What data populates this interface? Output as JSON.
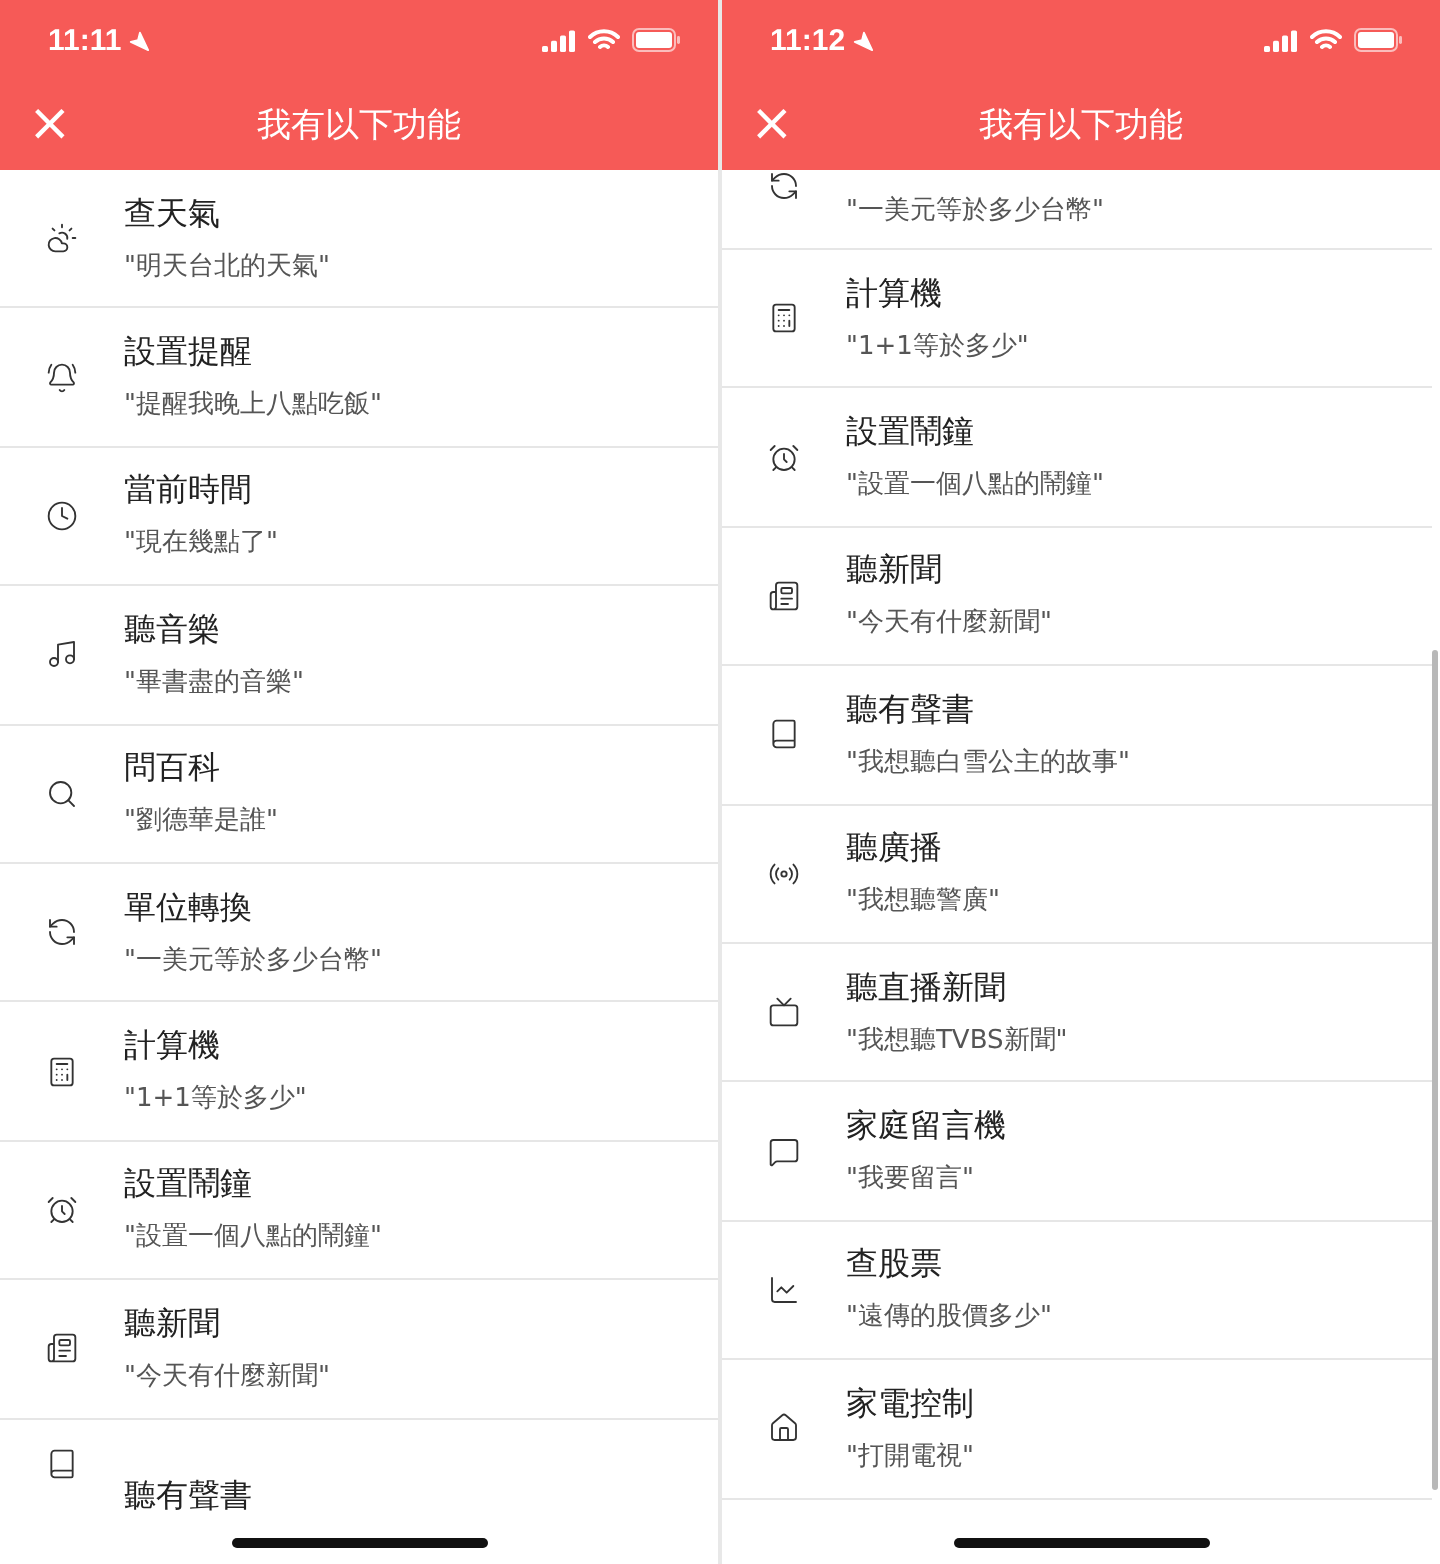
{
  "screens": [
    {
      "status_bar": {
        "time": "11:11"
      },
      "header": {
        "close": "×",
        "title": "我有以下功能"
      },
      "rows": [
        {
          "kind": "full",
          "title": "查天氣",
          "example": "\"明天台北的天氣\""
        },
        {
          "kind": "full",
          "title": "設置提醒",
          "example": "\"提醒我晚上八點吃飯\""
        },
        {
          "kind": "full",
          "title": "當前時間",
          "example": "\"現在幾點了\""
        },
        {
          "kind": "full",
          "title": "聽音樂",
          "example": "\"畢書盡的音樂\""
        },
        {
          "kind": "full",
          "title": "問百科",
          "example": "\"劉德華是誰\""
        },
        {
          "kind": "full",
          "title": "單位轉換",
          "example": "\"一美元等於多少台幣\""
        },
        {
          "kind": "full",
          "title": "計算機",
          "example": "\"1+1等於多少\""
        },
        {
          "kind": "full",
          "title": "設置鬧鐘",
          "example": "\"設置一個八點的鬧鐘\""
        },
        {
          "kind": "full",
          "title": "聽新聞",
          "example": "\"今天有什麼新聞\""
        },
        {
          "kind": "title_only",
          "title": "聽有聲書"
        }
      ]
    },
    {
      "status_bar": {
        "time": "11:12"
      },
      "header": {
        "close": "×",
        "title": "我有以下功能"
      },
      "rows": [
        {
          "kind": "example_only",
          "example": "\"一美元等於多少台幣\""
        },
        {
          "kind": "full",
          "title": "計算機",
          "example": "\"1+1等於多少\""
        },
        {
          "kind": "full",
          "title": "設置鬧鐘",
          "example": "\"設置一個八點的鬧鐘\""
        },
        {
          "kind": "full",
          "title": "聽新聞",
          "example": "\"今天有什麼新聞\""
        },
        {
          "kind": "full",
          "title": "聽有聲書",
          "example": "\"我想聽白雪公主的故事\""
        },
        {
          "kind": "full",
          "title": "聽廣播",
          "example": "\"我想聽警廣\""
        },
        {
          "kind": "full",
          "title": "聽直播新聞",
          "example": "\"我想聽TVBS新聞\""
        },
        {
          "kind": "full",
          "title": "家庭留言機",
          "example": "\"我要留言\""
        },
        {
          "kind": "full",
          "title": "查股票",
          "example": "\"遠傳的股價多少\""
        },
        {
          "kind": "full",
          "title": "家電控制",
          "example": "\"打開電視\""
        }
      ]
    }
  ]
}
